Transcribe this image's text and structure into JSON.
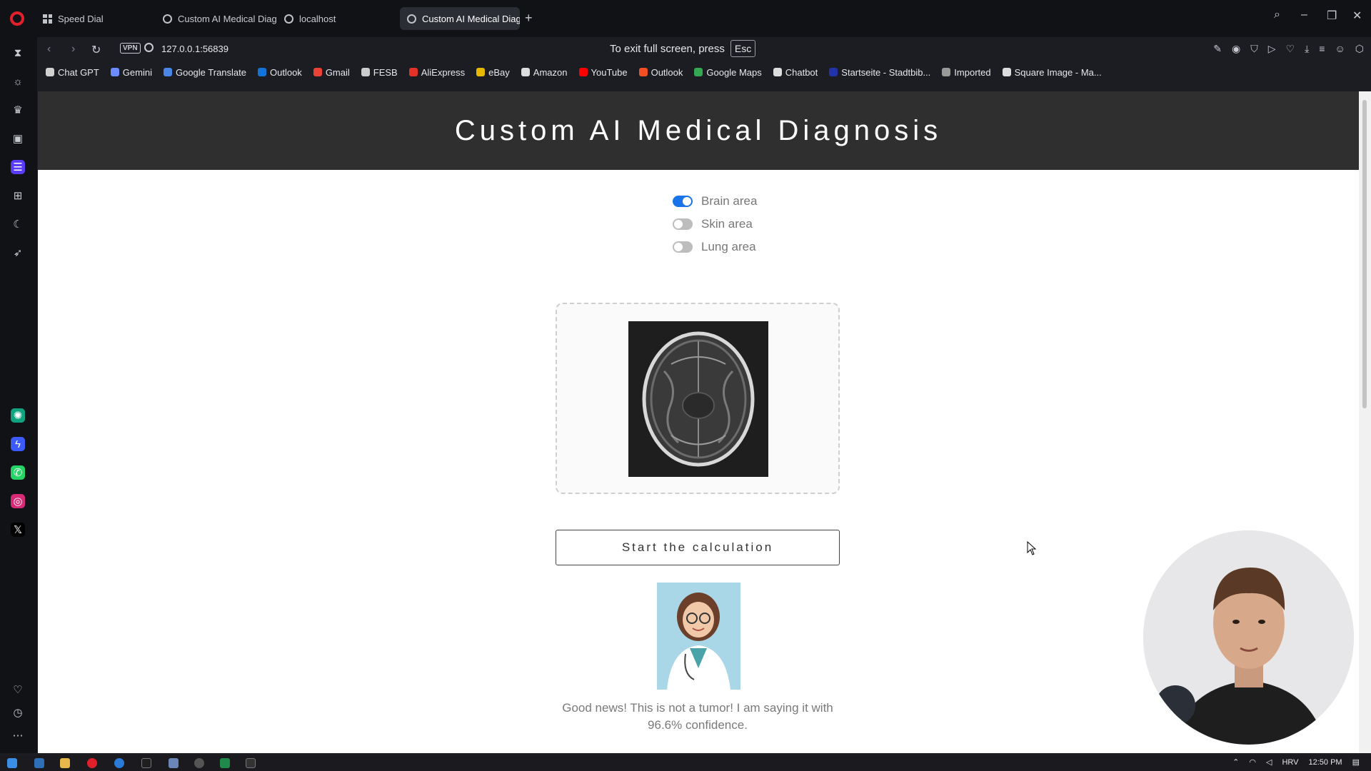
{
  "browser": {
    "tabs": [
      {
        "label": "Speed Dial",
        "icon": "speed-dial-icon",
        "active": false
      },
      {
        "label": "Custom AI Medical Diagnosis",
        "icon": "globe-icon",
        "active": false
      },
      {
        "label": "localhost",
        "icon": "globe-icon",
        "active": false
      },
      {
        "label": "Custom AI Medical Diagnosis",
        "icon": "globe-icon",
        "active": true
      }
    ],
    "new_tab": "+",
    "url": "127.0.0.1:56839",
    "vpn_label": "VPN",
    "fullscreen_notice": "To exit full screen, press",
    "esc_key": "Esc",
    "bookmarks": [
      {
        "label": "Chat GPT",
        "color": "#d1d1d1"
      },
      {
        "label": "Gemini",
        "color": "#6b8cff"
      },
      {
        "label": "Google Translate",
        "color": "#4a86e8"
      },
      {
        "label": "Outlook",
        "color": "#1273d8"
      },
      {
        "label": "Gmail",
        "color": "#ea4335"
      },
      {
        "label": "FESB",
        "color": "#cccccc"
      },
      {
        "label": "AliExpress",
        "color": "#e43226"
      },
      {
        "label": "eBay",
        "color": "#e6b800"
      },
      {
        "label": "Amazon",
        "color": "#dddddd"
      },
      {
        "label": "YouTube",
        "color": "#ff0000"
      },
      {
        "label": "Outlook",
        "color": "#f25022"
      },
      {
        "label": "Google Maps",
        "color": "#34a853"
      },
      {
        "label": "Chatbot",
        "color": "#dddddd"
      },
      {
        "label": "Startseite - Stadtbib...",
        "color": "#2233aa"
      },
      {
        "label": "Imported",
        "color": "#999999"
      },
      {
        "label": "Square Image - Ma...",
        "color": "#dddddd"
      }
    ]
  },
  "page": {
    "title": "Custom AI Medical Diagnosis",
    "toggles": [
      {
        "label": "Brain area",
        "on": true
      },
      {
        "label": "Skin area",
        "on": false
      },
      {
        "label": "Lung area",
        "on": false
      }
    ],
    "calc_button": "Start the calculation",
    "result_text": "Good news! This is not a tumor! I am saying it with 96.6% confidence."
  },
  "taskbar": {
    "language": "HRV",
    "time": "12:50 PM"
  },
  "colors": {
    "header_bg": "#2f2f2f",
    "toggle_on": "#1a73e8",
    "opera_red": "#e2202b",
    "sidebar_active": "#5b3cf6"
  }
}
